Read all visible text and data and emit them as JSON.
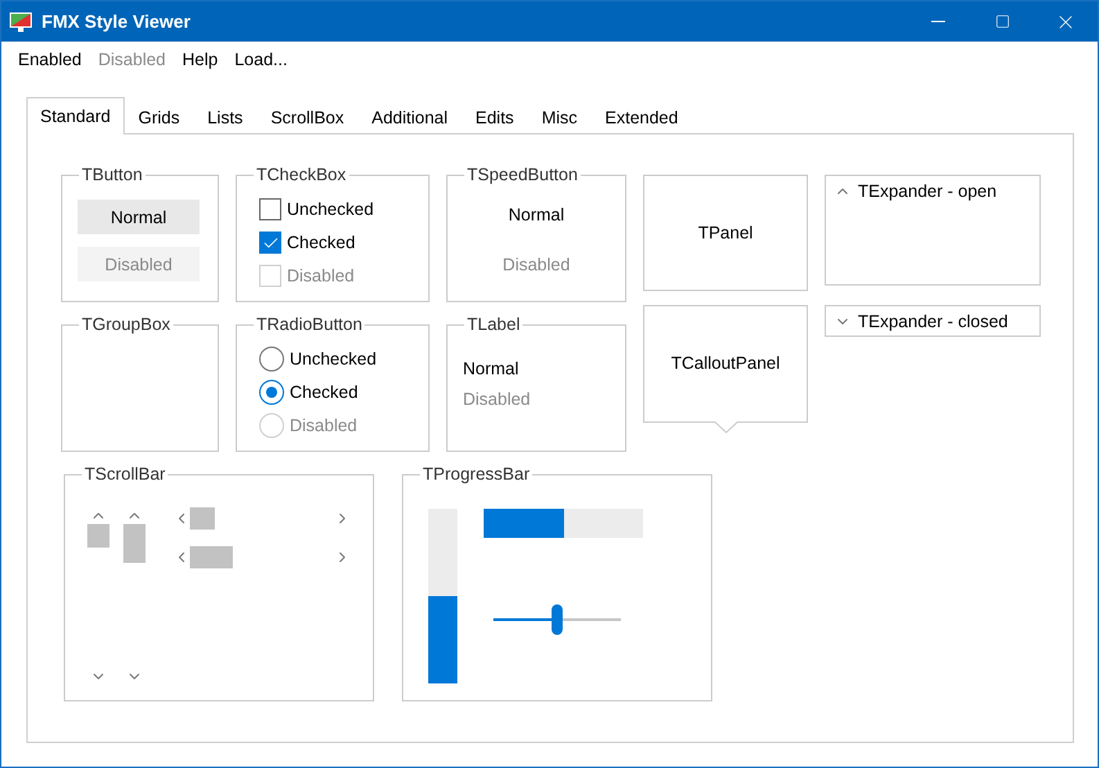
{
  "window": {
    "title": "FMX Style Viewer"
  },
  "menu": [
    {
      "label": "Enabled",
      "disabled": false
    },
    {
      "label": "Disabled",
      "disabled": true
    },
    {
      "label": "Help",
      "disabled": false
    },
    {
      "label": "Load...",
      "disabled": false
    }
  ],
  "tabs": [
    {
      "label": "Standard",
      "selected": true
    },
    {
      "label": "Grids",
      "selected": false
    },
    {
      "label": "Lists",
      "selected": false
    },
    {
      "label": "ScrollBox",
      "selected": false
    },
    {
      "label": "Additional",
      "selected": false
    },
    {
      "label": "Edits",
      "selected": false
    },
    {
      "label": "Misc",
      "selected": false
    },
    {
      "label": "Extended",
      "selected": false
    }
  ],
  "button_group": {
    "title": "TButton",
    "buttons": [
      {
        "label": "Normal",
        "disabled": false
      },
      {
        "label": "Disabled",
        "disabled": true
      }
    ]
  },
  "checkbox_group": {
    "title": "TCheckBox",
    "items": [
      {
        "label": "Unchecked",
        "checked": false,
        "disabled": false
      },
      {
        "label": "Checked",
        "checked": true,
        "disabled": false
      },
      {
        "label": "Disabled",
        "checked": false,
        "disabled": true
      }
    ]
  },
  "speedbutton_group": {
    "title": "TSpeedButton",
    "buttons": [
      {
        "label": "Normal",
        "disabled": false
      },
      {
        "label": "Disabled",
        "disabled": true
      }
    ]
  },
  "groupbox": {
    "title": "TGroupBox"
  },
  "radio_group": {
    "title": "TRadioButton",
    "items": [
      {
        "label": "Unchecked",
        "selected": false,
        "disabled": false
      },
      {
        "label": "Checked",
        "selected": true,
        "disabled": false
      },
      {
        "label": "Disabled",
        "selected": false,
        "disabled": true
      }
    ]
  },
  "label_group": {
    "title": "TLabel",
    "labels": [
      {
        "text": "Normal",
        "disabled": false
      },
      {
        "text": "Disabled",
        "disabled": true
      }
    ]
  },
  "panel": {
    "label": "TPanel"
  },
  "callout_panel": {
    "label": "TCalloutPanel"
  },
  "expanders": [
    {
      "title": "TExpander - open",
      "expanded": true
    },
    {
      "title": "TExpander - closed",
      "expanded": false
    }
  ],
  "scrollbar_group": {
    "title": "TScrollBar"
  },
  "progress_group": {
    "title": "TProgressBar",
    "vertical_progress_bar": {
      "level": 0.5
    },
    "horizontal_progress_bar": {
      "level": 0.5
    },
    "trackbar": {
      "level": 0.5
    }
  }
}
